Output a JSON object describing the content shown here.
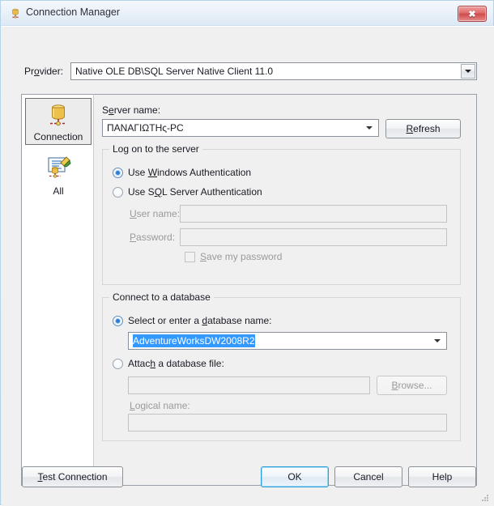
{
  "window": {
    "title": "Connection Manager",
    "icon": "database-cylinder-icon",
    "close_label": "✖"
  },
  "provider": {
    "label": "Pr",
    "label_accel": "o",
    "label_rest": "vider:",
    "label_full": "Provider:",
    "value": "Native OLE DB\\SQL Server Native Client 11.0"
  },
  "sidebar": {
    "items": [
      {
        "label": "Connection",
        "icon": "database-cylinder-icon",
        "selected": true
      },
      {
        "label": "All",
        "icon": "properties-page-icon",
        "selected": false
      }
    ]
  },
  "server": {
    "label_pre": "S",
    "label_accel": "e",
    "label_post": "rver name:",
    "label_full": "Server name:",
    "value": "ΠΑΝΑΓΙΩΤΗς-PC",
    "refresh_pre": "R",
    "refresh_accel": "R",
    "refresh_label": "Refresh",
    "refresh_rest": "efresh"
  },
  "logon": {
    "group_title": "Log on to the server",
    "windows_auth": {
      "pre": "Use ",
      "accel": "W",
      "rest": "indows Authentication",
      "full": "Use Windows Authentication",
      "checked": true
    },
    "sql_auth": {
      "pre": "Use S",
      "accel": "Q",
      "rest": "L Server Authentication",
      "full": "Use SQL Server Authentication",
      "checked": false
    },
    "username": {
      "pre": "U",
      "accel": "U",
      "rest": "ser name:",
      "label": "User name:",
      "value": "",
      "enabled": false
    },
    "password": {
      "pre": "P",
      "accel": "P",
      "rest": "assword:",
      "label": "Password:",
      "value": "",
      "enabled": false
    },
    "save_password": {
      "pre": "",
      "accel": "S",
      "rest": "ave my password",
      "label": "Save my password",
      "checked": false,
      "enabled": false
    }
  },
  "database": {
    "group_title": "Connect to a database",
    "select_name": {
      "pre": "Select or enter a ",
      "accel": "d",
      "rest": "atabase name:",
      "full": "Select or enter a database name:",
      "checked": true
    },
    "db_value": "AdventureWorksDW2008R2",
    "db_value_selected": true,
    "attach_file": {
      "pre": "Atta",
      "accel": "c",
      "rest": "h a database file:",
      "full": "Attach a database file:",
      "checked": false
    },
    "attach_path_value": "",
    "browse": {
      "pre": "",
      "accel": "B",
      "rest": "rowse...",
      "label": "Browse...",
      "enabled": false
    },
    "logical_name": {
      "pre": "",
      "accel": "L",
      "rest": "ogical name:",
      "label": "Logical name:",
      "value": "",
      "enabled": false
    }
  },
  "footer": {
    "test_connection": {
      "pre": "",
      "accel": "T",
      "rest": "est Connection",
      "label": "Test Connection"
    },
    "ok": "OK",
    "cancel": "Cancel",
    "help": "Help"
  },
  "colors": {
    "accent_selection": "#3399ff",
    "default_button_border": "#2f9fd9",
    "close_button": "#cf4a4a",
    "dialog_bg": "#f0f0f0"
  }
}
